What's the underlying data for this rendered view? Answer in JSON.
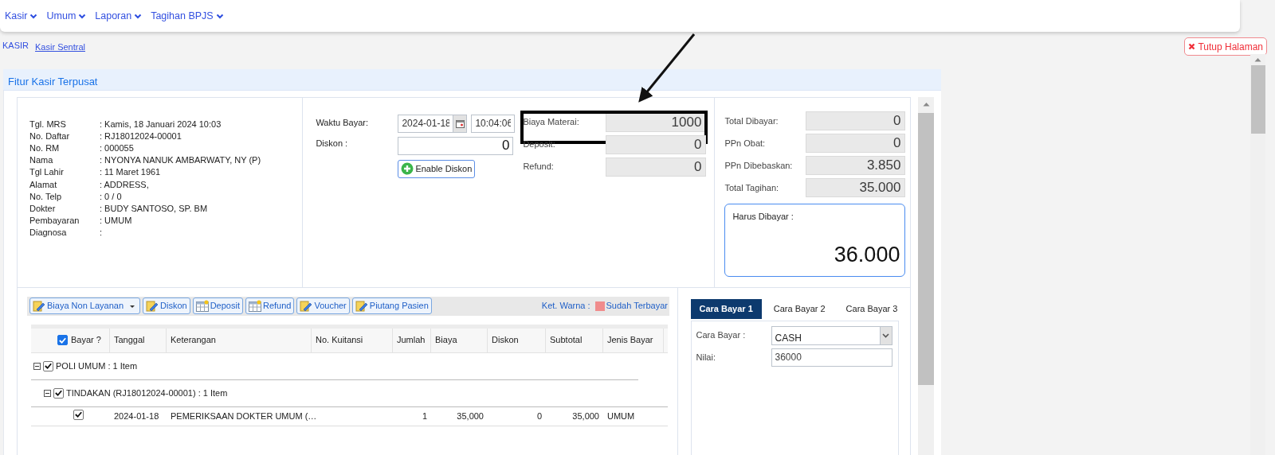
{
  "nav_menu": [
    {
      "label": "Kasir"
    },
    {
      "label": "Umum"
    },
    {
      "label": "Laporan"
    },
    {
      "label": "Tagihan BPJS"
    }
  ],
  "breadcrumb": [
    {
      "label": "KASIR",
      "kind": "text"
    },
    {
      "label": "Kasir Sentral",
      "kind": "link"
    }
  ],
  "close_button": "Tutup Halaman",
  "panel": {
    "title": "Fitur Kasir Terpusat"
  },
  "patient": [
    {
      "label": "Tgl. MRS",
      "value": ": Kamis, 18 Januari 2024 10:03"
    },
    {
      "label": "No. Daftar",
      "value": ": RJ18012024-00001"
    },
    {
      "label": "No. RM",
      "value": ": 000055"
    },
    {
      "label": "Nama",
      "value": ": NYONYA NANUK AMBARWATY, NY (P)"
    },
    {
      "label": "Tgl Lahir",
      "value": ": 11 Maret 1961"
    },
    {
      "label": "Alamat",
      "value": ": ADDRESS,"
    },
    {
      "label": "No. Telp",
      "value": ": 0 / 0"
    },
    {
      "label": "Dokter",
      "value": ": BUDY SANTOSO, SP. BM"
    },
    {
      "label": "Pembayaran",
      "value": ": UMUM"
    },
    {
      "label": "Diagnosa",
      "value": ":"
    }
  ],
  "payment_time": {
    "label": "Waktu Bayar:",
    "date": "2024-01-18",
    "time": "10:04:06"
  },
  "discount": {
    "label": "Diskon :",
    "value": "0",
    "button": "Enable Diskon"
  },
  "charges": [
    {
      "label": "Biaya Materai:",
      "value": "1000",
      "highlighted": true
    },
    {
      "label": "Deposit:",
      "value": "0",
      "highlighted": false
    },
    {
      "label": "Refund:",
      "value": "0",
      "highlighted": false
    }
  ],
  "totals": [
    {
      "label": "Total Dibayar:",
      "value": "0"
    },
    {
      "label": "PPn Obat:",
      "value": "0"
    },
    {
      "label": "PPn Dibebaskan:",
      "value": "3.850"
    },
    {
      "label": "Total Tagihan:",
      "value": "35.000"
    }
  ],
  "amount_due": {
    "label": "Harus Dibayar :",
    "value": "36.000"
  },
  "toolbar": [
    {
      "label": "Biaya Non Layanan",
      "kind": "edit",
      "dropdown": true
    },
    {
      "label": "Diskon",
      "kind": "edit",
      "dropdown": false
    },
    {
      "label": "Deposit",
      "kind": "sheet",
      "dropdown": false
    },
    {
      "label": "Refund",
      "kind": "sheet",
      "dropdown": false
    },
    {
      "label": "Voucher",
      "kind": "edit",
      "dropdown": false
    },
    {
      "label": "Piutang Pasien",
      "kind": "edit",
      "dropdown": false
    }
  ],
  "legend": {
    "label": "Ket. Warna :",
    "items": [
      {
        "label": "Sudah Terbayar",
        "color": "#f08c8c"
      }
    ]
  },
  "grid": {
    "select_all": true,
    "columns": [
      {
        "label": "Bayar ?"
      },
      {
        "label": "Tanggal"
      },
      {
        "label": "Keterangan"
      },
      {
        "label": "No. Kuitansi"
      },
      {
        "label": "Jumlah"
      },
      {
        "label": "Biaya"
      },
      {
        "label": "Diskon"
      },
      {
        "label": "Subtotal"
      },
      {
        "label": "Jenis Bayar"
      }
    ],
    "groups": [
      {
        "label": "POLI UMUM : 1 Item",
        "expanded": true,
        "checked": true,
        "children": [
          {
            "label": "TINDAKAN (RJ18012024-00001) : 1 Item",
            "expanded": true,
            "checked": true,
            "rows": [
              {
                "checked": true,
                "tanggal": "2024-01-18",
                "keterangan": "PEMERIKSAAN DOKTER UMUM (…",
                "jumlah": "1",
                "biaya": "35,000",
                "diskon": "0",
                "subtotal": "35,000",
                "jenis_bayar": "UMUM"
              }
            ]
          }
        ]
      }
    ]
  },
  "payment_tabs": [
    {
      "label": "Cara Bayar 1",
      "selected": true
    },
    {
      "label": "Cara Bayar 2",
      "selected": false
    },
    {
      "label": "Cara Bayar 3",
      "selected": false
    }
  ],
  "payment_form": {
    "method_label": "Cara Bayar :",
    "method": "CASH",
    "value_label": "Nilai:",
    "value": "36000"
  }
}
